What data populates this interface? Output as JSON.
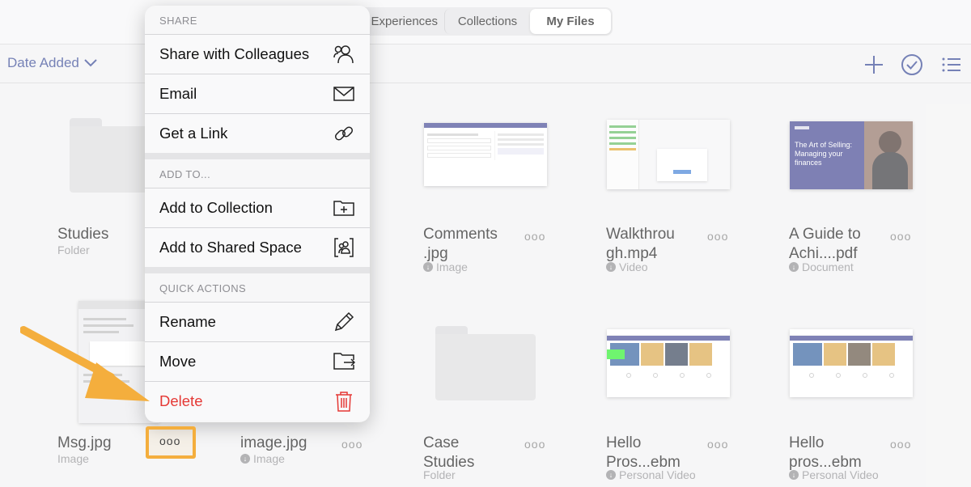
{
  "segments": [
    "Experiences",
    "Collections",
    "My Files"
  ],
  "sort_label": "Date Added",
  "icons": {
    "add": "plus-icon",
    "select": "check-circle-icon",
    "view": "list-icon"
  },
  "menu": {
    "share_header": "SHARE",
    "share_items": [
      "Share with Colleagues",
      "Email",
      "Get a Link"
    ],
    "add_header": "ADD TO...",
    "add_items": [
      "Add to Collection",
      "Add to Shared Space"
    ],
    "quick_header": "QUICK ACTIONS",
    "quick_items": [
      "Rename",
      "Move",
      "Delete"
    ]
  },
  "tiles": [
    {
      "name": "Studies",
      "sub": "Folder",
      "kind": "folder"
    },
    {
      "name": "Comments\n.jpg",
      "sub": "Image",
      "kind": "image"
    },
    {
      "name": "Walkthrou\ngh.mp4",
      "sub": "Video",
      "kind": "video"
    },
    {
      "name": "A Guide to\nAchi....pdf",
      "sub": "Document",
      "kind": "document",
      "thumb_text": "The Art of Selling: Managing your finances"
    },
    {
      "name": "Msg.jpg",
      "sub": "Image",
      "kind": "image"
    },
    {
      "name": "image.jpg",
      "sub": "Image",
      "kind": "image"
    },
    {
      "name": "Case\nStudies",
      "sub": "Folder",
      "kind": "folder"
    },
    {
      "name": "Hello\nPros...ebm",
      "sub": "Personal Video",
      "kind": "video"
    },
    {
      "name": "Hello\npros...ebm",
      "sub": "Personal Video",
      "kind": "video"
    }
  ],
  "more_glyph": "ooo",
  "colors": {
    "accent": "#2c3e8f",
    "delete": "#e53935",
    "highlight": "#f4ae3d"
  }
}
